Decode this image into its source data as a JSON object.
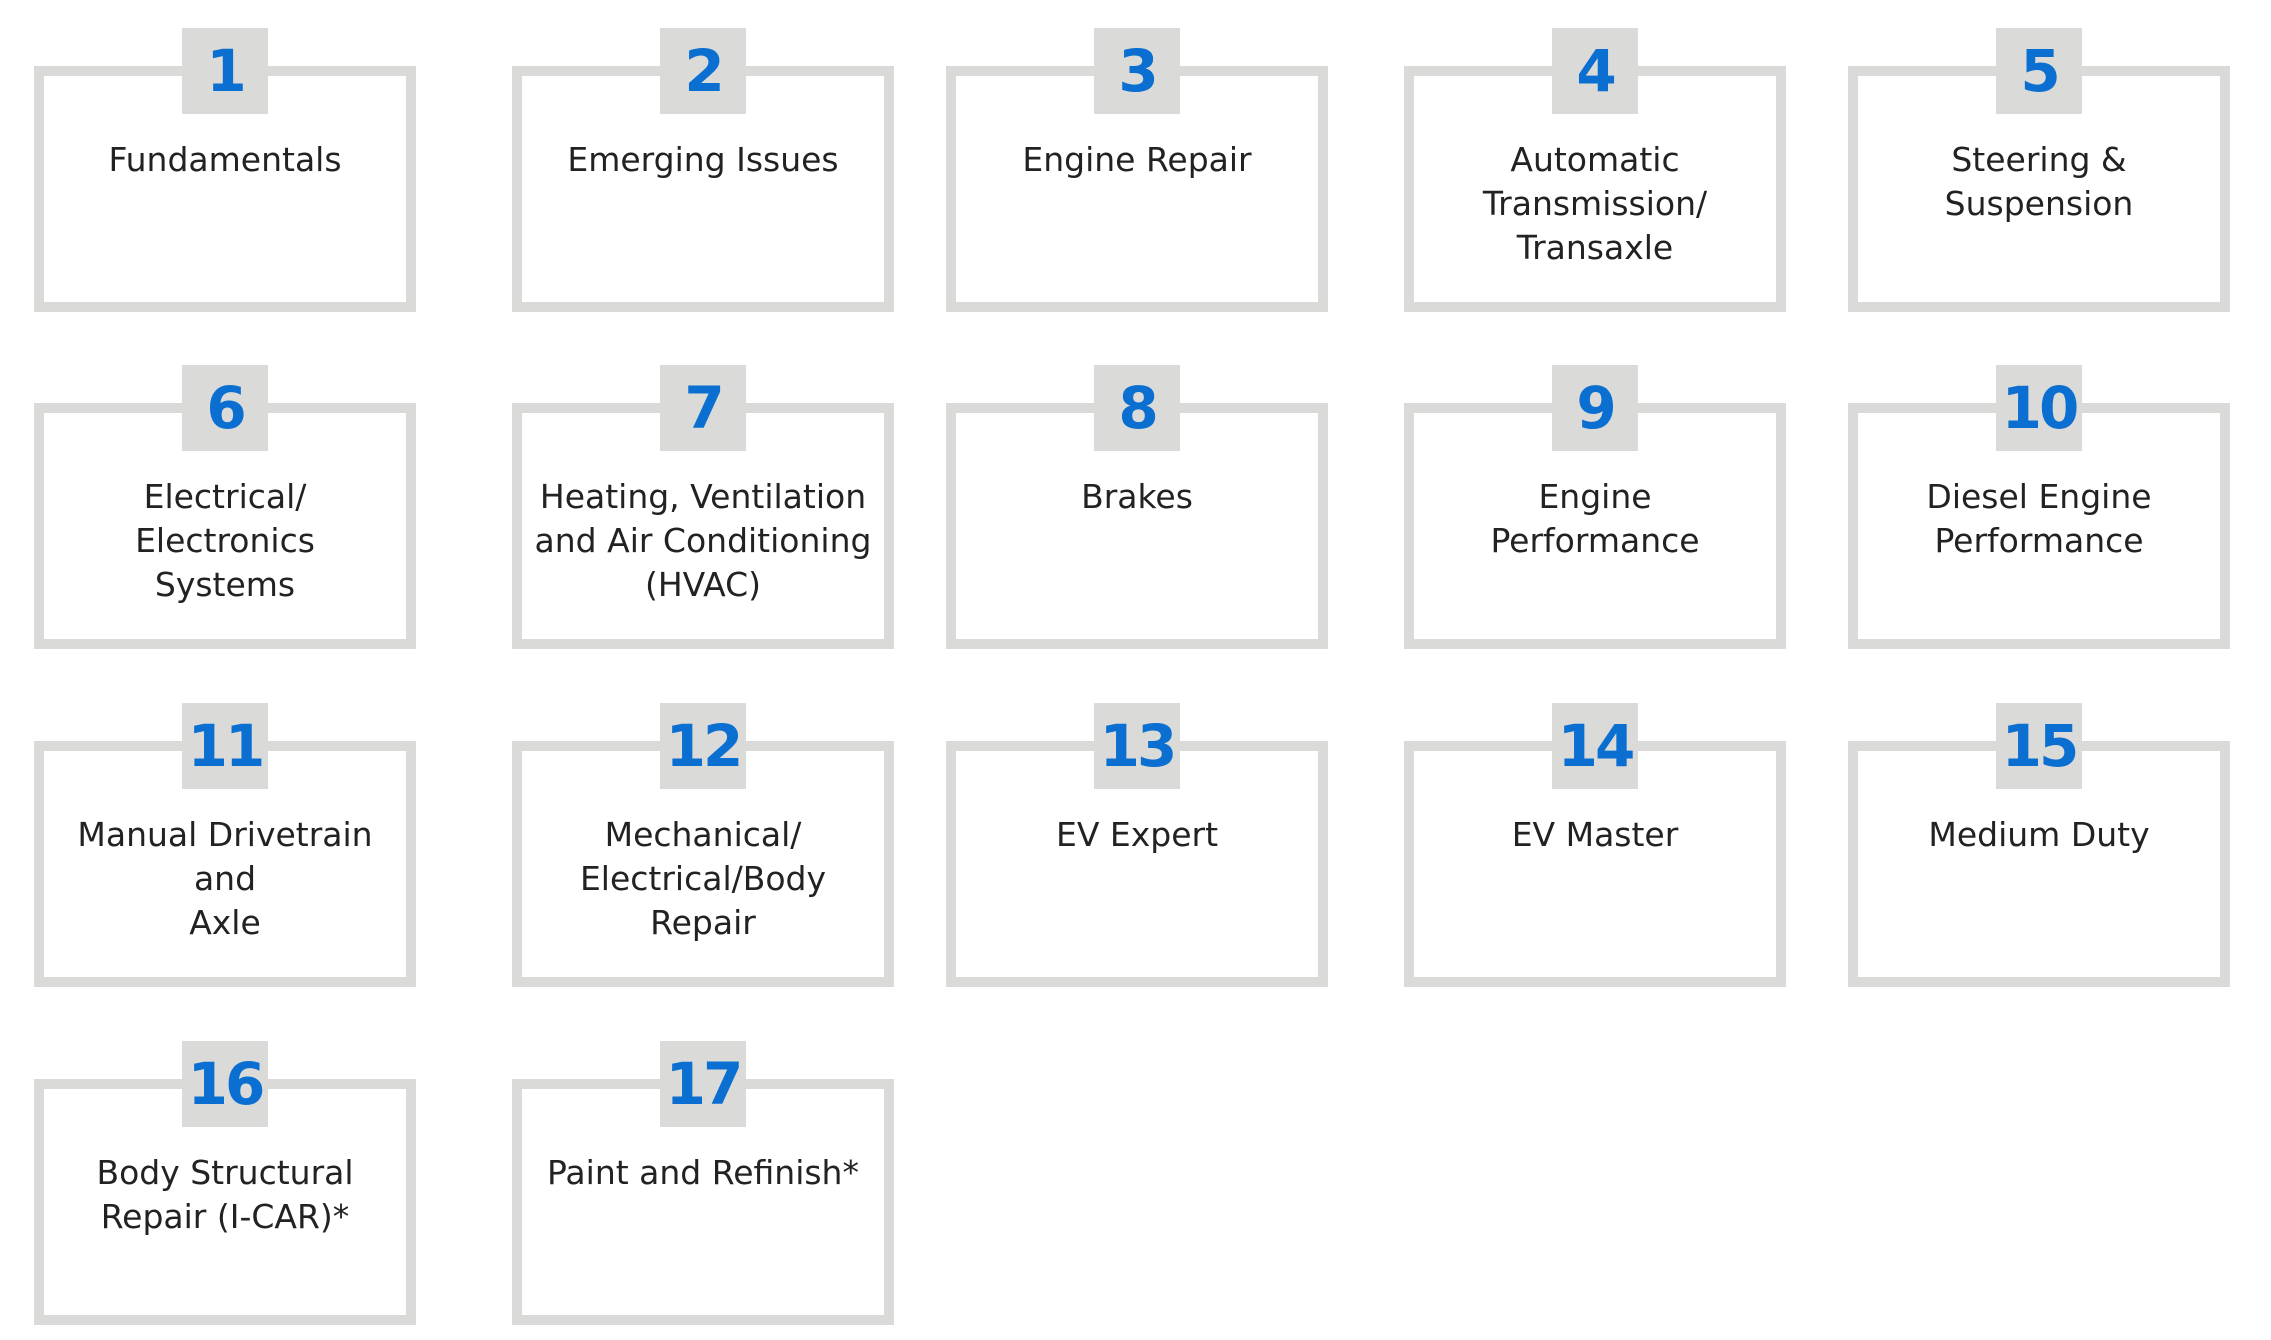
{
  "colors": {
    "number": "#0a6fd0",
    "border": "#dadad8",
    "text": "#222222"
  },
  "modules": [
    {
      "number": "1",
      "title": "Fundamentals"
    },
    {
      "number": "2",
      "title": "Emerging Issues"
    },
    {
      "number": "3",
      "title": "Engine Repair"
    },
    {
      "number": "4",
      "title": "Automatic\nTransmission/\nTransaxle"
    },
    {
      "number": "5",
      "title": "Steering &\nSuspension"
    },
    {
      "number": "6",
      "title": "Electrical/\nElectronics\nSystems"
    },
    {
      "number": "7",
      "title": "Heating, Ventilation\nand Air Conditioning\n(HVAC)"
    },
    {
      "number": "8",
      "title": "Brakes"
    },
    {
      "number": "9",
      "title": "Engine\nPerformance"
    },
    {
      "number": "10",
      "title": "Diesel Engine\nPerformance"
    },
    {
      "number": "11",
      "title": "Manual Drivetrain and\nAxle"
    },
    {
      "number": "12",
      "title": "Mechanical/\nElectrical/Body\nRepair"
    },
    {
      "number": "13",
      "title": "EV Expert"
    },
    {
      "number": "14",
      "title": "EV Master"
    },
    {
      "number": "15",
      "title": "Medium Duty"
    },
    {
      "number": "16",
      "title": "Body Structural\nRepair (I-CAR)*"
    },
    {
      "number": "17",
      "title": "Paint and Refinish*"
    }
  ]
}
